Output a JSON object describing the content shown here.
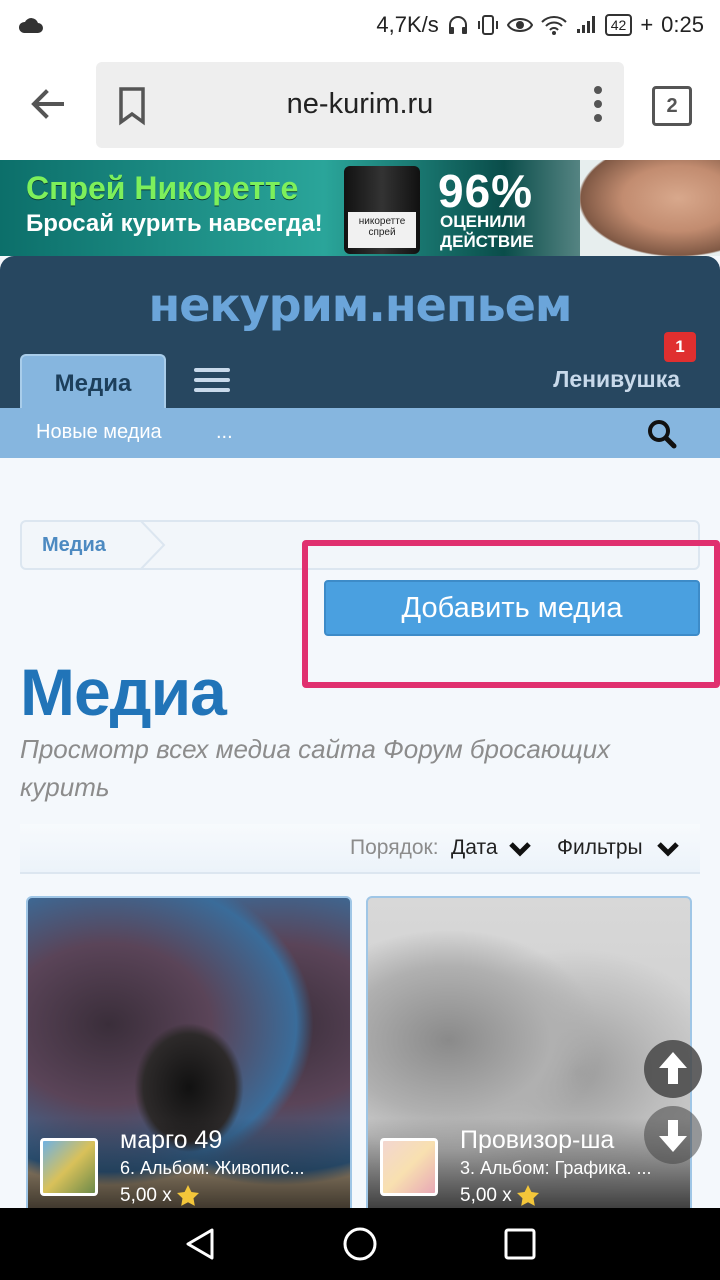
{
  "status_bar": {
    "speed": "4,7K/s",
    "battery": "42",
    "time": "0:25"
  },
  "browser": {
    "url": "ne-kurim.ru",
    "tab_count": "2"
  },
  "ad": {
    "line1": "Спрей Никоретте",
    "line2": "Бросай курить навсегда!",
    "product": "никоретте спрей",
    "percent": "96%",
    "rating_line1": "ОЦЕНИЛИ",
    "rating_line2": "ДЕЙСТВИЕ"
  },
  "site": {
    "logo": "некурим.непьем",
    "nav_tab": "Медиа",
    "username": "Ленивушка",
    "notification_count": "1",
    "subnav": [
      "Новые медиа",
      "..."
    ]
  },
  "breadcrumb": "Медиа",
  "add_button": "Добавить медиа",
  "page": {
    "title": "Медиа",
    "description": "Просмотр всех медиа сайта Форум бросающих курить"
  },
  "filter": {
    "order_label": "Порядок:",
    "order_value": "Дата",
    "filters_label": "Фильтры"
  },
  "cards": [
    {
      "title": "марго 49",
      "album": "6. Альбом: Живопис...",
      "rating": "5,00 х"
    },
    {
      "title": "Провизор-ша",
      "album": "3. Альбом: Графика. ...",
      "rating": "5,00 х"
    }
  ],
  "icons": {
    "back": "arrow-left-icon",
    "bookmark": "bookmark-icon",
    "more": "more-vert-icon",
    "search": "search-icon",
    "star": "star-icon",
    "scroll_up": "arrow-up-icon",
    "scroll_down": "arrow-down-icon"
  },
  "colors": {
    "header_bg": "#274760",
    "accent": "#2174b8",
    "button": "#4aa0e0",
    "highlight": "#e0306f",
    "notification": "#e02f2f"
  }
}
